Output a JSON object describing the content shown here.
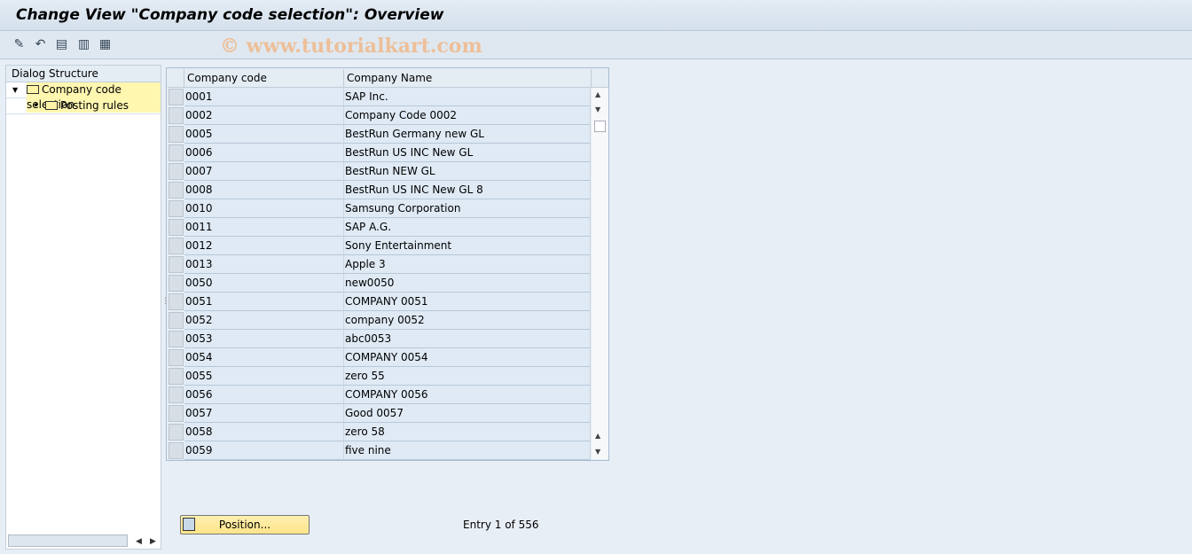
{
  "title": "Change View \"Company code selection\": Overview",
  "toolbar": {
    "icons": [
      "change-display-icon",
      "undo-icon",
      "select-all-icon",
      "select-block-icon",
      "deselect-all-icon"
    ]
  },
  "watermark": "© www.tutorialkart.com",
  "dialog": {
    "header": "Dialog Structure",
    "items": [
      {
        "label": "Company code selection",
        "selected": true
      },
      {
        "label": "Posting rules",
        "selected": false
      }
    ]
  },
  "table": {
    "columns": [
      "Company code",
      "Company Name"
    ],
    "rows": [
      [
        "0001",
        "SAP Inc."
      ],
      [
        "0002",
        "Company Code 0002"
      ],
      [
        "0005",
        "BestRun Germany new GL"
      ],
      [
        "0006",
        "BestRun US INC New GL"
      ],
      [
        "0007",
        "BestRun NEW GL"
      ],
      [
        "0008",
        "BestRun US INC New GL 8"
      ],
      [
        "0010",
        "Samsung Corporation"
      ],
      [
        "0011",
        "SAP A.G."
      ],
      [
        "0012",
        "Sony Entertainment"
      ],
      [
        "0013",
        "Apple 3"
      ],
      [
        "0050",
        "new0050"
      ],
      [
        "0051",
        "COMPANY 0051"
      ],
      [
        "0052",
        "company 0052"
      ],
      [
        "0053",
        "abc0053"
      ],
      [
        "0054",
        "COMPANY 0054"
      ],
      [
        "0055",
        "zero 55"
      ],
      [
        "0056",
        "COMPANY 0056"
      ],
      [
        "0057",
        "Good 0057"
      ],
      [
        "0058",
        "zero 58"
      ],
      [
        "0059",
        "five nine"
      ]
    ]
  },
  "position_button": "Position...",
  "entry_text": "Entry 1 of 556"
}
